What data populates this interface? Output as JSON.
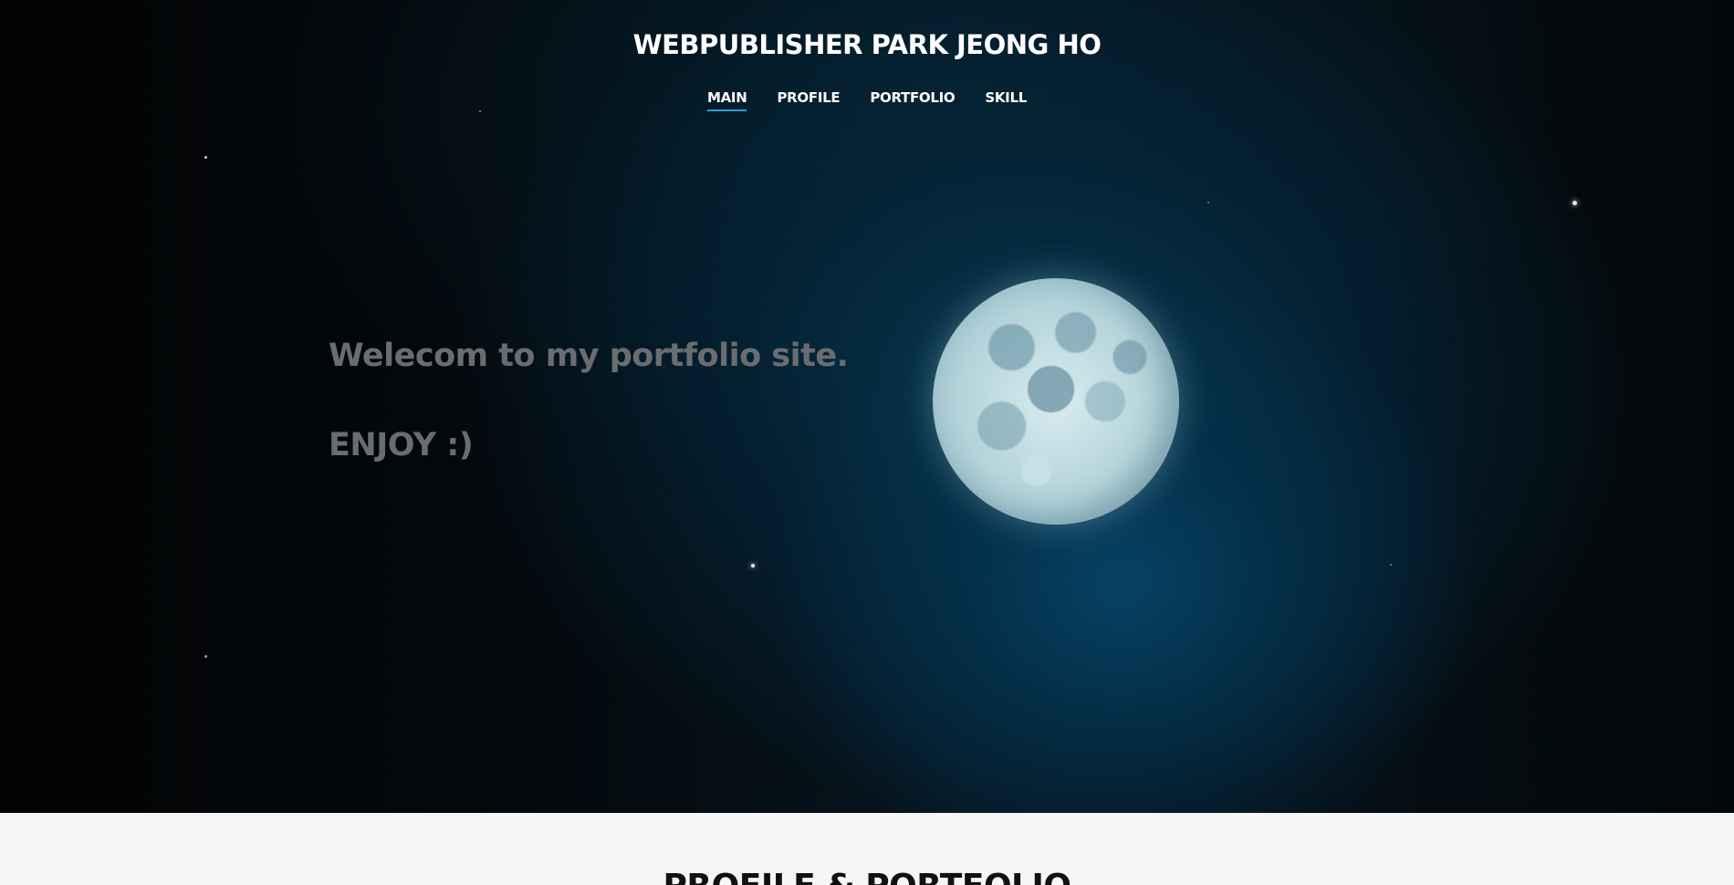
{
  "header": {
    "title": "WEBPUBLISHER PARK JEONG HO"
  },
  "nav": {
    "items": [
      {
        "label": "MAIN",
        "active": true
      },
      {
        "label": "PROFILE",
        "active": false
      },
      {
        "label": "PORTFOLIO",
        "active": false
      },
      {
        "label": "SKILL",
        "active": false
      }
    ]
  },
  "hero": {
    "welcome_text": "Welecom to my portfolio site.",
    "enjoy_text": "ENJOY :)",
    "background_image": "moon-night-sky"
  },
  "section": {
    "heading": "PROFILE & PORTFOLIO"
  },
  "colors": {
    "nav_active_underline": "#2a9cd8",
    "hero_text": "#6a6d70",
    "section_bg": "#f6f6f6"
  }
}
